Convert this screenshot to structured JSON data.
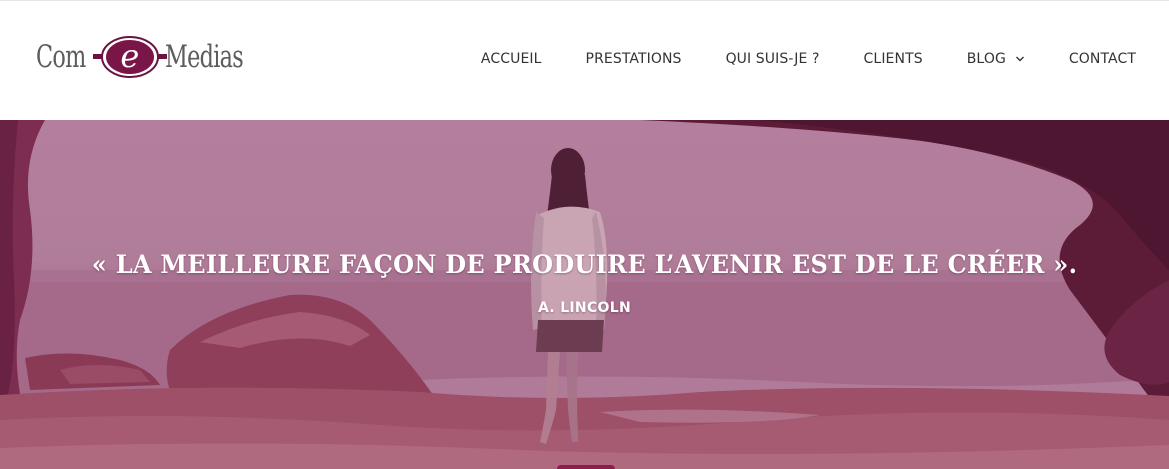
{
  "logo": {
    "left_word": "Com",
    "emblem_letter": "e",
    "right_word": "Medias"
  },
  "nav": {
    "items": [
      {
        "label": "ACCUEIL"
      },
      {
        "label": "PRESTATIONS"
      },
      {
        "label": "QUI SUIS-JE ?"
      },
      {
        "label": "CLIENTS"
      },
      {
        "label": "BLOG",
        "has_dropdown": true
      },
      {
        "label": "CONTACT"
      }
    ]
  },
  "hero": {
    "quote": "« LA MEILLEURE FAÇON DE PRODUIRE L’AVENIR EST DE LE CRÉER ».",
    "author": "A. LINCOLN"
  },
  "colors": {
    "brand": "#7a1647",
    "overlay": "#a85c86",
    "slider_indicator": "#8e1c4d"
  },
  "icons": {
    "blog_dropdown": "chevron-down-icon"
  }
}
